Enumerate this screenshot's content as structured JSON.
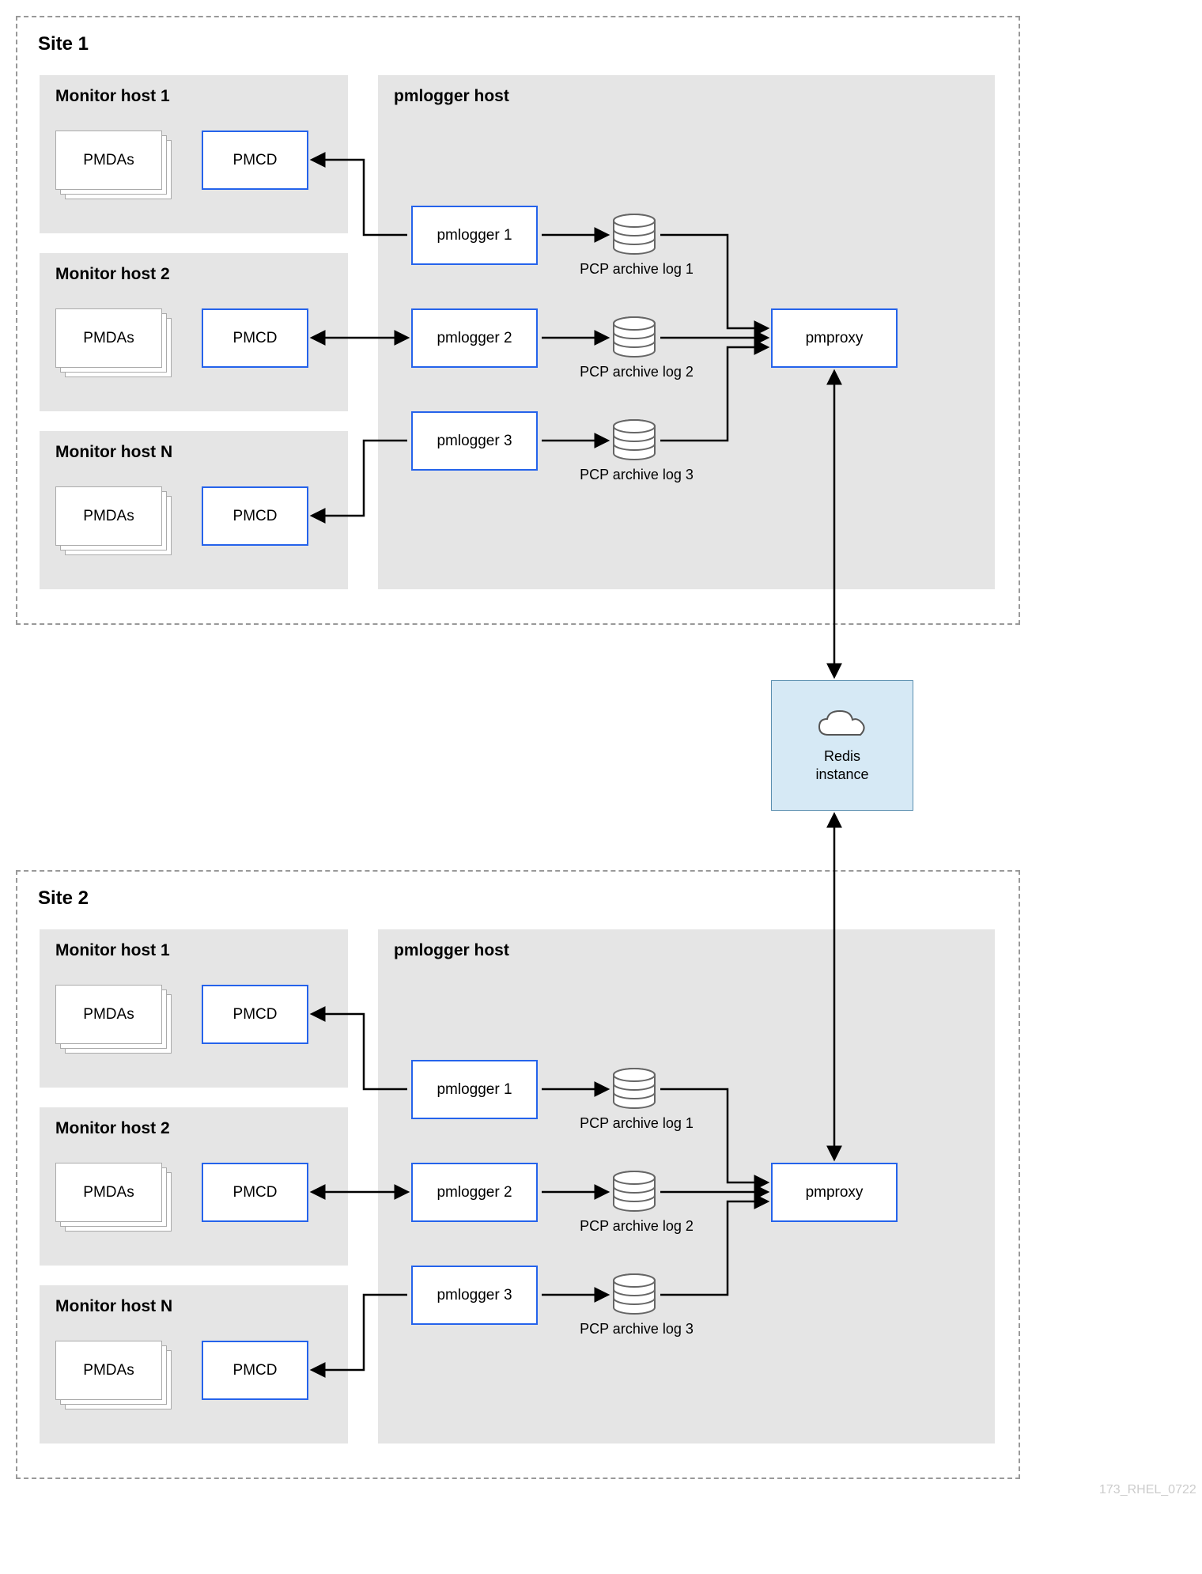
{
  "sites": [
    {
      "title": "Site 1",
      "monitor_hosts": [
        {
          "title": "Monitor host 1",
          "pmdas": "PMDAs",
          "pmcd": "PMCD"
        },
        {
          "title": "Monitor host 2",
          "pmdas": "PMDAs",
          "pmcd": "PMCD"
        },
        {
          "title": "Monitor host N",
          "pmdas": "PMDAs",
          "pmcd": "PMCD"
        }
      ],
      "pmlogger_host": {
        "title": "pmlogger host",
        "loggers": [
          {
            "name": "pmlogger 1",
            "archive": "PCP archive log 1"
          },
          {
            "name": "pmlogger 2",
            "archive": "PCP archive log 2"
          },
          {
            "name": "pmlogger 3",
            "archive": "PCP archive log 3"
          }
        ],
        "pmproxy": "pmproxy"
      }
    },
    {
      "title": "Site 2",
      "monitor_hosts": [
        {
          "title": "Monitor host 1",
          "pmdas": "PMDAs",
          "pmcd": "PMCD"
        },
        {
          "title": "Monitor host 2",
          "pmdas": "PMDAs",
          "pmcd": "PMCD"
        },
        {
          "title": "Monitor host N",
          "pmdas": "PMDAs",
          "pmcd": "PMCD"
        }
      ],
      "pmlogger_host": {
        "title": "pmlogger host",
        "loggers": [
          {
            "name": "pmlogger 1",
            "archive": "PCP archive log 1"
          },
          {
            "name": "pmlogger 2",
            "archive": "PCP archive log 2"
          },
          {
            "name": "pmlogger 3",
            "archive": "PCP archive log 3"
          }
        ],
        "pmproxy": "pmproxy"
      }
    }
  ],
  "redis": {
    "label_line1": "Redis",
    "label_line2": "instance"
  },
  "caption": "173_RHEL_0722"
}
